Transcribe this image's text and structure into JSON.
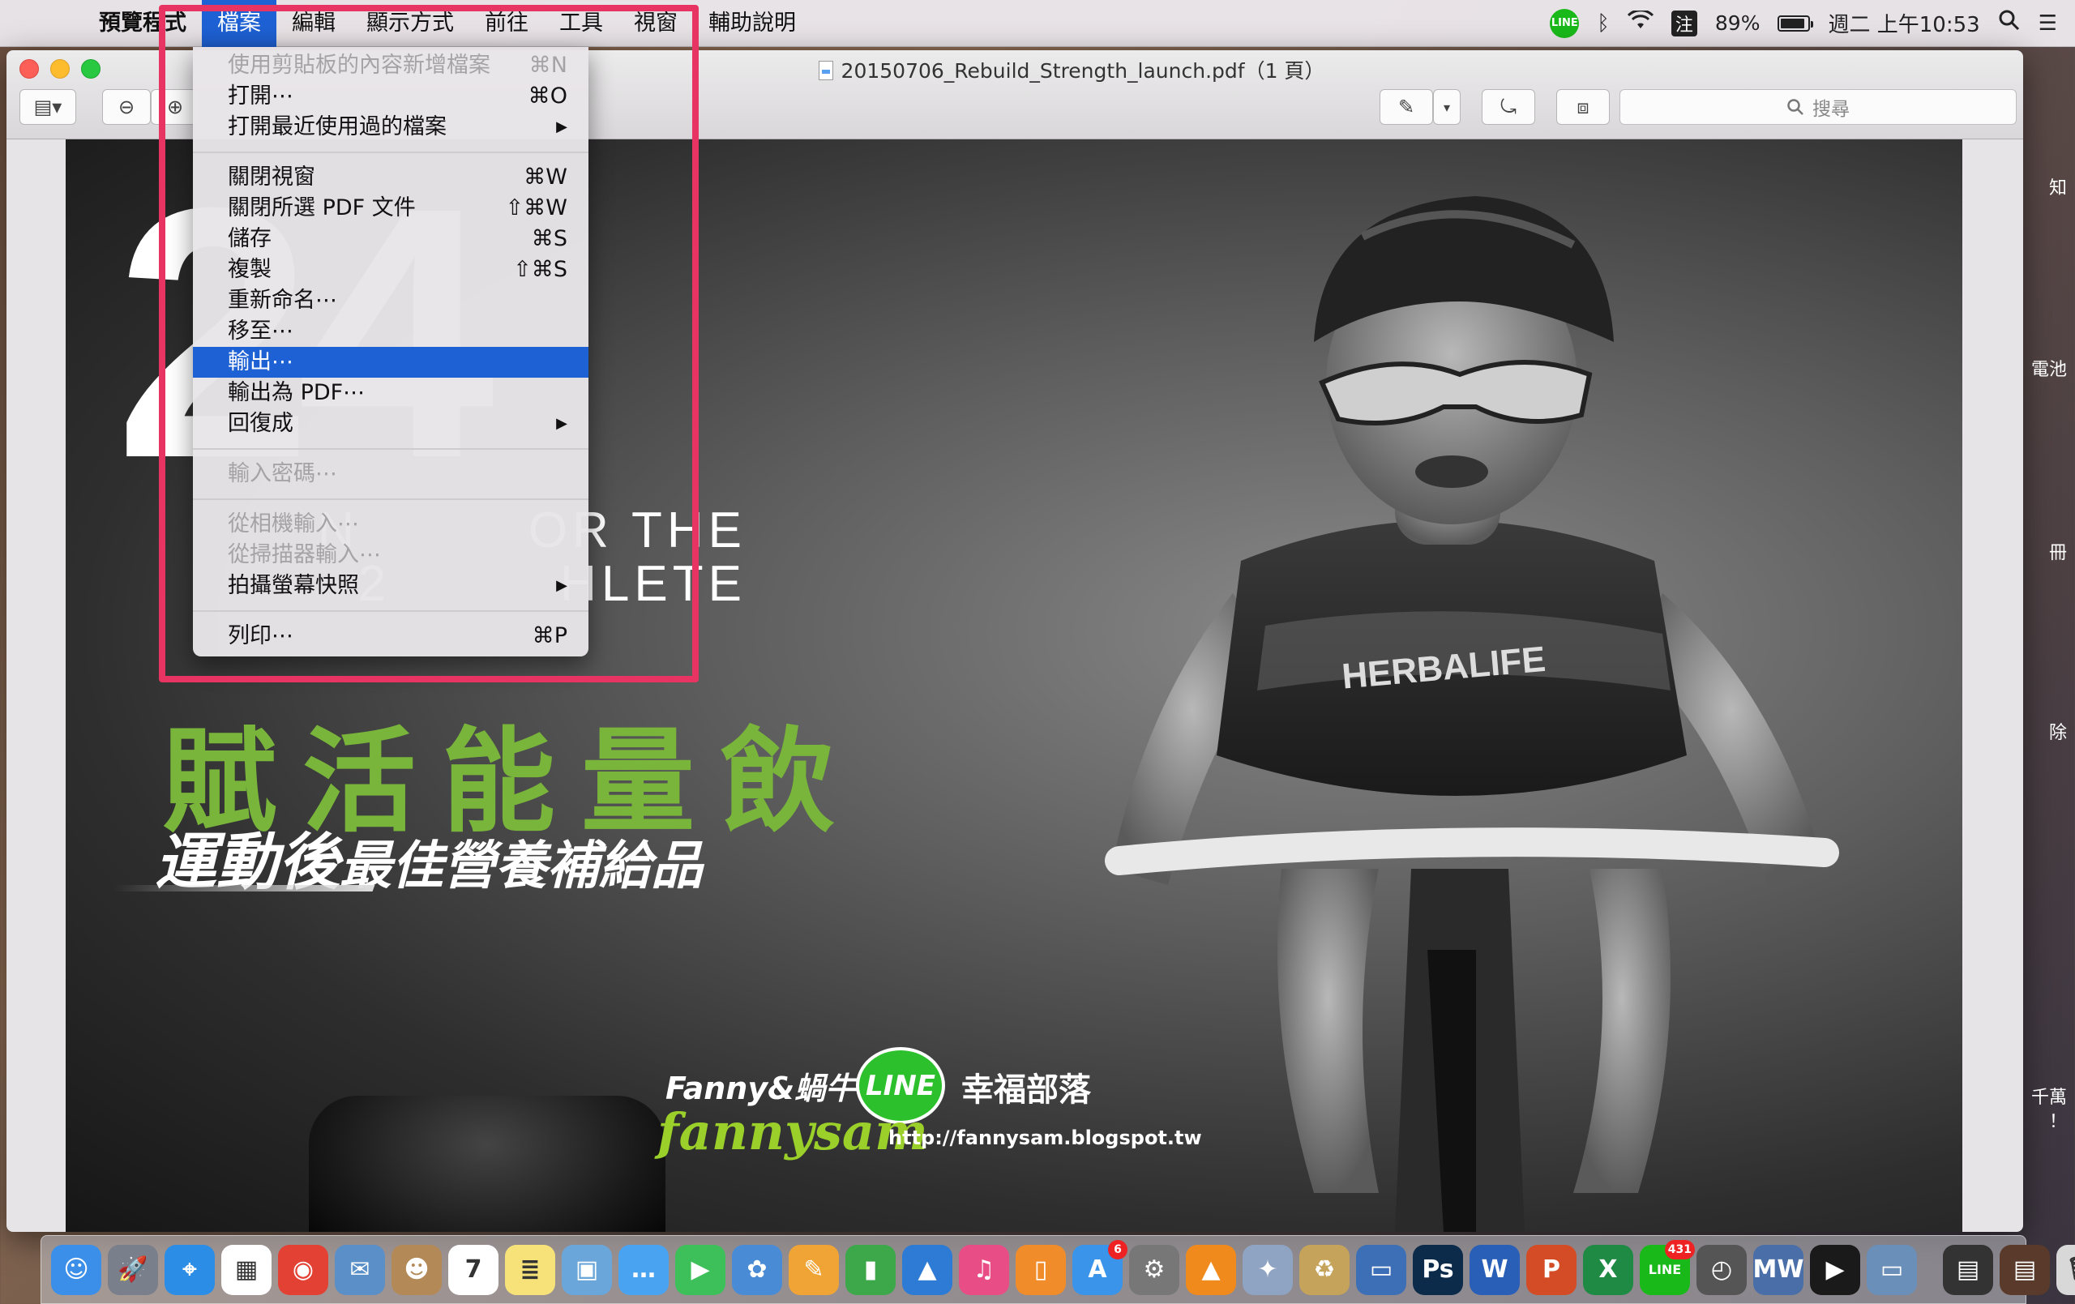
{
  "menubar": {
    "app_name": "預覽程式",
    "menus": [
      "檔案",
      "編輯",
      "顯示方式",
      "前往",
      "工具",
      "視窗",
      "輔助說明"
    ],
    "line_label": "LINE",
    "ime_label": "注",
    "battery_percent": "89%",
    "battery_level": 0.89,
    "datetime": "週二 上午10:53"
  },
  "window": {
    "title": "20150706_Rebuild_Strength_launch.pdf（1 頁）",
    "search_placeholder": "搜尋"
  },
  "file_menu": {
    "items": [
      {
        "label": "使用剪貼板的內容新增檔案",
        "shortcut": "⌘N",
        "enabled": false
      },
      {
        "label": "打開⋯",
        "shortcut": "⌘O",
        "enabled": true
      },
      {
        "label": "打開最近使用過的檔案",
        "shortcut": "▶",
        "enabled": true
      },
      {
        "label": "關閉視窗",
        "shortcut": "⌘W",
        "enabled": true
      },
      {
        "label": "關閉所選 PDF 文件",
        "shortcut": "⇧⌘W",
        "enabled": true
      },
      {
        "label": "儲存",
        "shortcut": "⌘S",
        "enabled": true
      },
      {
        "label": "複製",
        "shortcut": "⇧⌘S",
        "enabled": true
      },
      {
        "label": "重新命名⋯",
        "shortcut": "",
        "enabled": true
      },
      {
        "label": "移至⋯",
        "shortcut": "",
        "enabled": true
      },
      {
        "label": "輸出⋯",
        "shortcut": "",
        "enabled": true,
        "highlighted": true
      },
      {
        "label": "輸出為 PDF⋯",
        "shortcut": "",
        "enabled": true
      },
      {
        "label": "回復成",
        "shortcut": "▶",
        "enabled": true
      },
      {
        "label": "輸入密碼⋯",
        "shortcut": "",
        "enabled": false
      },
      {
        "label": "從相機輸入⋯",
        "shortcut": "",
        "enabled": false
      },
      {
        "label": "從掃描器輸入⋯",
        "shortcut": "",
        "enabled": false
      },
      {
        "label": "拍攝螢幕快照",
        "shortcut": "▶",
        "enabled": true
      },
      {
        "label": "列印⋯",
        "shortcut": "⌘P",
        "enabled": true
      }
    ]
  },
  "poster": {
    "big_number": "24",
    "tagline_line1": "N         OR THE",
    "tagline_line2": "2         HLETE",
    "headline_green": "賦活能量飲",
    "headline_white_a": "運動後",
    "headline_white_b": "最佳營養補給品",
    "jersey_text": "HERBALIFE"
  },
  "watermark": {
    "name": "Fanny&蝸牛",
    "line_logo": "LINE",
    "blog_name": "幸福部落",
    "script_name": "fannysam",
    "url": "http://fannysam.blogspot.tw"
  },
  "edge_fragments": [
    "知",
    "電池",
    "冊",
    "除",
    "千萬",
    "！"
  ],
  "dock": {
    "apps": [
      {
        "name": "Finder",
        "glyph": "☺",
        "color": "#3b8fe8"
      },
      {
        "name": "Launchpad",
        "glyph": "🚀",
        "color": "#7a7f8c"
      },
      {
        "name": "Safari",
        "glyph": "⌖",
        "color": "#2c8de6"
      },
      {
        "name": "Apps",
        "glyph": "▦",
        "color": "#ffffff"
      },
      {
        "name": "Chrome",
        "glyph": "◉",
        "color": "#e34133"
      },
      {
        "name": "Mail",
        "glyph": "✉",
        "color": "#5a8fc8"
      },
      {
        "name": "Contacts",
        "glyph": "☻",
        "color": "#b38a57"
      },
      {
        "name": "Calendar",
        "glyph": "7",
        "color": "#ffffff"
      },
      {
        "name": "Notes",
        "glyph": "≣",
        "color": "#f7e27a"
      },
      {
        "name": "Preview",
        "glyph": "▣",
        "color": "#6aa6d9"
      },
      {
        "name": "Messages",
        "glyph": "…",
        "color": "#4aa3f0"
      },
      {
        "name": "FaceTime",
        "glyph": "▶",
        "color": "#3dbf5a"
      },
      {
        "name": "Photos",
        "glyph": "✿",
        "color": "#4a8bd6"
      },
      {
        "name": "Pages",
        "glyph": "✎",
        "color": "#f1a436"
      },
      {
        "name": "Numbers",
        "glyph": "▮",
        "color": "#3ca84a"
      },
      {
        "name": "Keynote",
        "glyph": "▲",
        "color": "#2e7bd6"
      },
      {
        "name": "iTunes",
        "glyph": "♫",
        "color": "#e94d86"
      },
      {
        "name": "iBooks",
        "glyph": "▯",
        "color": "#f08c2a"
      },
      {
        "name": "App Store",
        "glyph": "A",
        "color": "#3a94ea",
        "badge": "6"
      },
      {
        "name": "System Preferences",
        "glyph": "⚙",
        "color": "#777777"
      },
      {
        "name": "VLC",
        "glyph": "▲",
        "color": "#f18a1c"
      },
      {
        "name": "Directory Utility",
        "glyph": "✦",
        "color": "#8fa4c2"
      },
      {
        "name": "Archive",
        "glyph": "♻",
        "color": "#c6a35a"
      },
      {
        "name": "Screen Sharing",
        "glyph": "▭",
        "color": "#3c6fb5"
      },
      {
        "name": "Photoshop",
        "glyph": "Ps",
        "color": "#0c2a4a"
      },
      {
        "name": "Word",
        "glyph": "W",
        "color": "#2a5fb8"
      },
      {
        "name": "PowerPoint",
        "glyph": "P",
        "color": "#d44c26"
      },
      {
        "name": "Excel",
        "glyph": "X",
        "color": "#1f8a44"
      },
      {
        "name": "LINE",
        "glyph": "LINE",
        "color": "#19b919",
        "badge": "431"
      },
      {
        "name": "Time Machine",
        "glyph": "◴",
        "color": "#555555"
      },
      {
        "name": "MW",
        "glyph": "MW",
        "color": "#4a6fa8"
      },
      {
        "name": "QuickTime",
        "glyph": "▶",
        "color": "#1a1a1a"
      },
      {
        "name": "Image Capture",
        "glyph": "▭",
        "color": "#6a8fb8"
      }
    ],
    "stack_apps": [
      {
        "name": "Downloads",
        "glyph": "▤",
        "color": "#333333"
      },
      {
        "name": "Documents",
        "glyph": "▤",
        "color": "#5a3a2a"
      },
      {
        "name": "Trash",
        "glyph": "🗑",
        "color": "#d8d8d8"
      }
    ]
  }
}
